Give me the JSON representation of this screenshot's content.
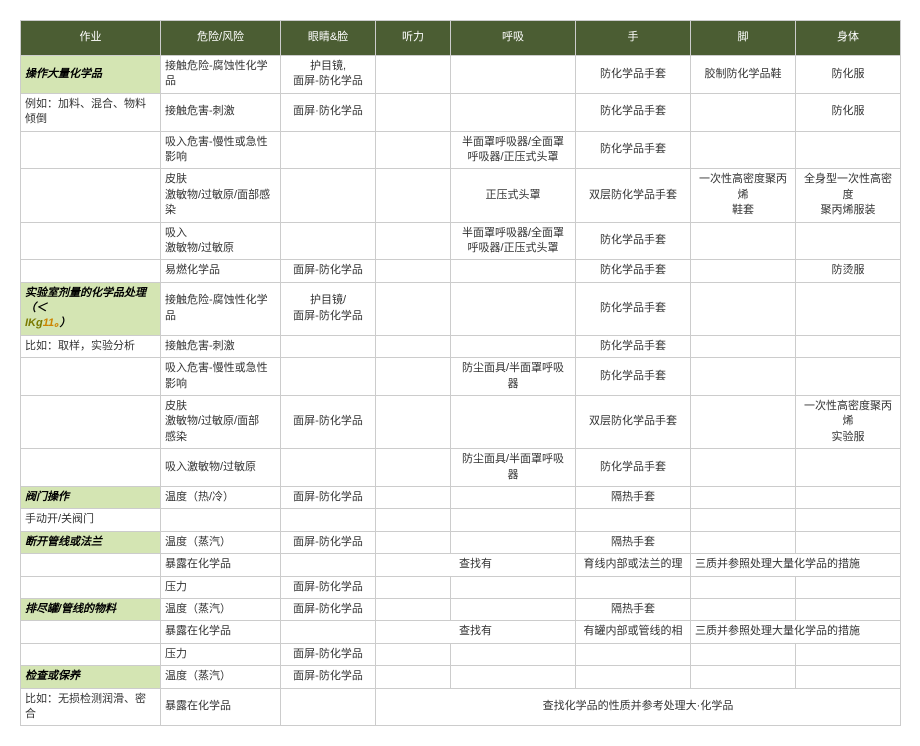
{
  "headers": [
    "作业",
    "危险/风险",
    "眼睛&脸",
    "听力",
    "呼吸",
    "手",
    "脚",
    "身体"
  ],
  "sections": [
    {
      "title": "操作大量化学品",
      "title_row_data": [
        "接触危险-腐蚀性化学品",
        "护目镜,\n面屏-防化学品",
        "",
        "",
        "防化学品手套",
        "胶制防化学品鞋",
        "防化服"
      ],
      "note": "例如：加料、混合、物料倾倒",
      "rows": [
        [
          "",
          "接触危害-刺激",
          "面屏·防化学品",
          "",
          "",
          "防化学品手套",
          "",
          "防化服"
        ],
        [
          "",
          "吸入危害-慢性或急性影响",
          "",
          "",
          "半面罩呼吸器/全面罩\n呼吸器/正压式头罩",
          "防化学品手套",
          "",
          ""
        ],
        [
          "",
          "皮肤\n激敏物/过敏原/面部感染",
          "",
          "",
          "正压式头罩",
          "双层防化学品手套",
          "一次性高密度聚丙烯\n鞋套",
          "全身型一次性高密度\n聚丙烯服装"
        ],
        [
          "",
          "吸入\n激敏物/过敏原",
          "",
          "",
          "半面罩呼吸器/全面罩\n呼吸器/正压式头罩",
          "防化学品手套",
          "",
          ""
        ],
        [
          "",
          "易燃化学品",
          "面屏-防化学品",
          "",
          "",
          "防化学品手套",
          "",
          "防烫服"
        ]
      ]
    },
    {
      "title_html": "<span class='ital'>实验室剂量的化学品处理（＜</span><br><span class='hl'>IKg</span><span class='ital' style='color:#cc8400'>11。</span><span class='ital'>）</span>",
      "title_row_data": [
        "接触危险-腐蚀性化学品",
        "护目镜/\n面屏-防化学品",
        "",
        "",
        "防化学品手套",
        "",
        ""
      ],
      "note": "比如：取样，实验分析",
      "rows": [
        [
          "",
          "接触危害-刺激",
          "",
          "",
          "",
          "防化学品手套",
          "",
          ""
        ],
        [
          "",
          "吸入危害-慢性或急性影响",
          "",
          "",
          "防尘面具/半面罩呼吸\n器",
          "防化学品手套",
          "",
          ""
        ],
        [
          "",
          "皮肤\n激敏物/过敏原/面部\n感染",
          "面屏-防化学品",
          "",
          "",
          "双层防化学品手套",
          "",
          "一次性高密度聚丙烯\n实验服"
        ],
        [
          "",
          "吸入激敏物/过敏原",
          "",
          "",
          "防尘面具/半面罩呼吸\n器",
          "防化学品手套",
          "",
          ""
        ]
      ]
    },
    {
      "title": "阀门操作",
      "title_row_data": [
        "温度（热/冷）",
        "面屏-防化学品",
        "",
        "",
        "隔热手套",
        "",
        ""
      ],
      "note": "手动开/关阀门",
      "rows": []
    },
    {
      "title": "断开管线或法兰",
      "title_row_data": [
        "温度（蒸汽）",
        "面屏-防化学品",
        "",
        "",
        "隔热手套",
        "",
        ""
      ],
      "rows": [
        [
          "",
          "暴露在化学品",
          "",
          {
            "colspan": 2,
            "text": "查找有"
          },
          "育线内部或法兰的理",
          {
            "colspan": 2,
            "text": "三质并参照处理大量化学品的措施",
            "left": true
          }
        ],
        [
          "",
          "压力",
          "面屏-防化学品",
          "",
          "",
          "",
          "",
          ""
        ]
      ]
    },
    {
      "title": "排尽罐/管线的物料",
      "title_row_data": [
        "温度（蒸汽）",
        "面屏-防化学品",
        "",
        "",
        "隔热手套",
        "",
        ""
      ],
      "rows": [
        [
          "",
          "暴露在化学品",
          "",
          {
            "colspan": 2,
            "text": "查找有"
          },
          "有罐内部或管线的相",
          {
            "colspan": 2,
            "text": "三质并参照处理大量化学品的措施",
            "left": true
          }
        ],
        [
          "",
          "压力",
          "面屏-防化学品",
          "",
          "",
          "",
          "",
          ""
        ]
      ]
    },
    {
      "title": "检查或保养",
      "title_row_data": [
        "温度（蒸汽）",
        "面屏-防化学品",
        "",
        "",
        "",
        "",
        ""
      ],
      "note": "比如：无损检测润滑、密合",
      "rows": [
        [
          "",
          "暴露在化学品",
          "",
          {
            "colspan": 5,
            "text": "查找化学品的性质并参考处理大·化学品"
          }
        ]
      ]
    }
  ]
}
